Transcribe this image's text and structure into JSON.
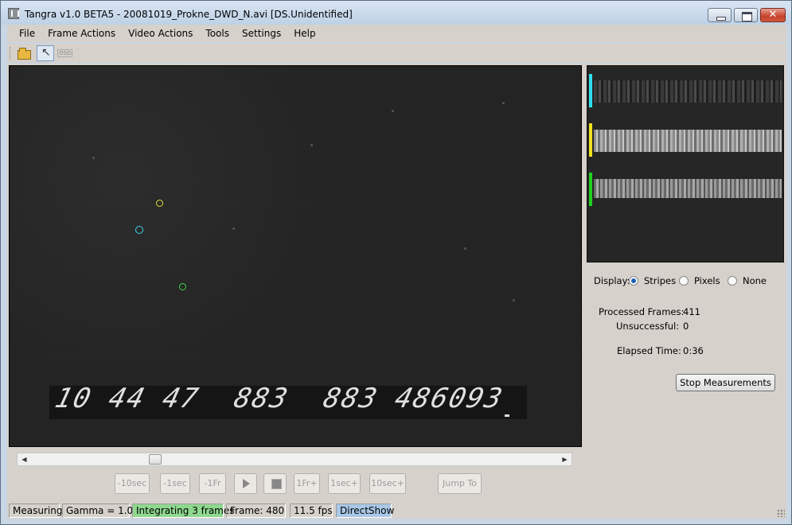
{
  "window": {
    "title": "Tangra v1.0 BETA5 - 20081019_Prokne_DWD_N.avi [DS.Unidentified]"
  },
  "menu": [
    {
      "label": "File"
    },
    {
      "label": "Frame Actions"
    },
    {
      "label": "Video Actions"
    },
    {
      "label": "Tools"
    },
    {
      "label": "Settings"
    },
    {
      "label": "Help"
    }
  ],
  "toolbar": {
    "osd_label": "OSD"
  },
  "video": {
    "osd_timestamp": "10 44 47  883  883 486093",
    "target_colors": {
      "yellow": "#e8e040",
      "cyan": "#40d8e8",
      "green": "#40d840"
    }
  },
  "playback": {
    "buttons": [
      {
        "label": "-10sec"
      },
      {
        "label": "-1sec"
      },
      {
        "label": "-1Fr"
      },
      {
        "label": ""
      },
      {
        "label": ""
      },
      {
        "label": "1Fr+"
      },
      {
        "label": "1sec+"
      },
      {
        "label": "10sec+"
      }
    ],
    "jump_to": "Jump To"
  },
  "right_panel": {
    "stripe_colors": [
      "#2ee0f0",
      "#f0e020",
      "#20d020"
    ],
    "display_label": "Display:",
    "display_options": [
      {
        "label": "Stripes",
        "selected": true
      },
      {
        "label": "Pixels",
        "selected": false
      },
      {
        "label": "None",
        "selected": false
      }
    ],
    "processed_frames_label": "Processed Frames:",
    "processed_frames_value": "411",
    "unsuccessful_label": "Unsuccessful:",
    "unsuccessful_value": "0",
    "elapsed_time_label": "Elapsed Time:",
    "elapsed_time_value": "0:36",
    "stop_button": "Stop Measurements"
  },
  "statusbar": {
    "mode": "Measuring",
    "gamma": "Gamma = 1.00",
    "integrating": "Integrating 3 frames",
    "frame": "Frame: 480",
    "fps": "11.5 fps",
    "engine": "DirectShow",
    "integrating_color": "#8fd88f",
    "engine_color": "#a9c8e8"
  }
}
